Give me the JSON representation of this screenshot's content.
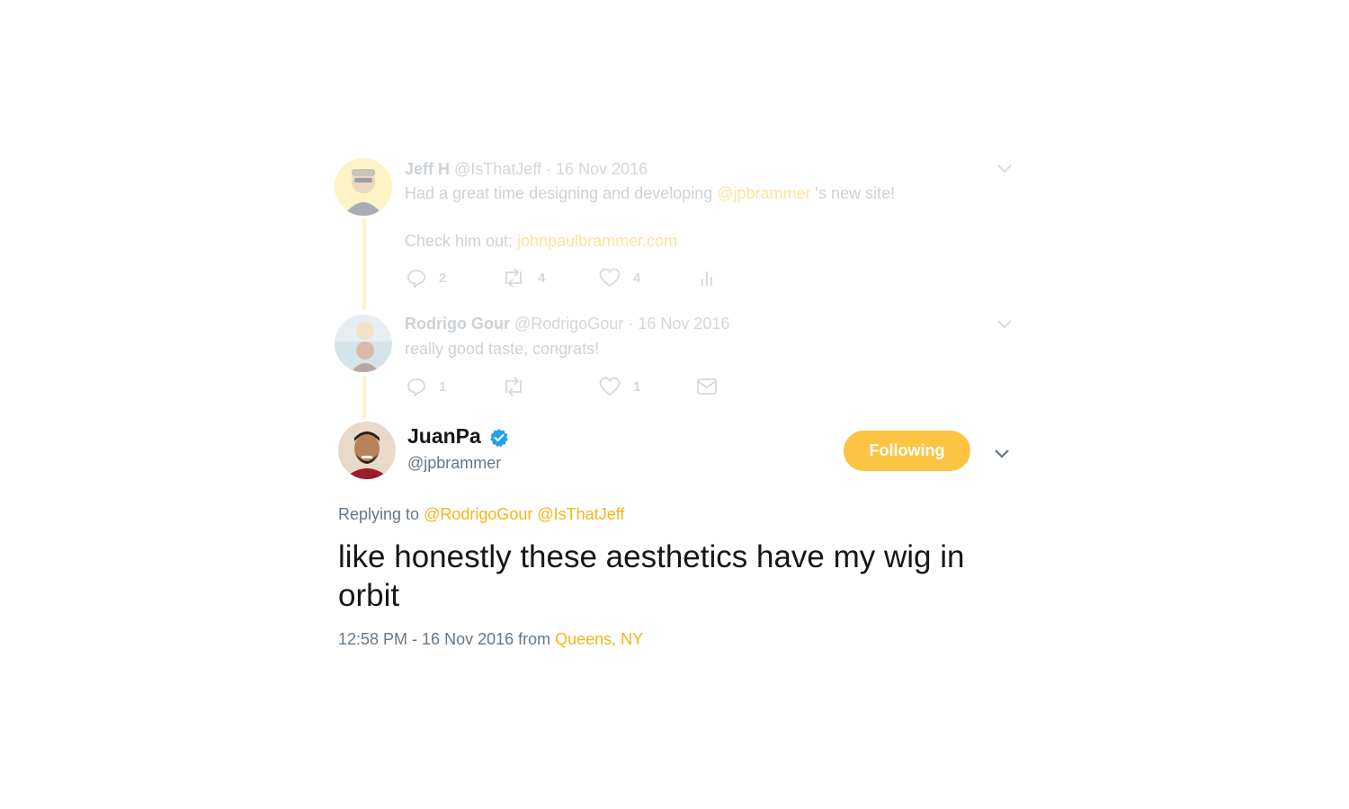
{
  "thread": [
    {
      "name": "Jeff H",
      "handle": "@IsThatJeff",
      "separator": "·",
      "date": "16 Nov 2016",
      "text_prefix": "Had a great time designing and developing ",
      "mention": "@jpbrammer",
      "text_suffix": " 's new site!",
      "text2_prefix": "Check him out: ",
      "link": "johnpaulbrammer.com",
      "replies": "2",
      "retweets": "4",
      "likes": "4"
    },
    {
      "name": "Rodrigo Gour",
      "handle": "@RodrigoGour",
      "separator": "·",
      "date": "16 Nov 2016",
      "text": "really good taste, congrats!",
      "replies": "1",
      "retweets": "",
      "likes": "1"
    }
  ],
  "main": {
    "name": "JuanPa",
    "handle": "@jpbrammer",
    "follow_label": "Following",
    "replying_prefix": "Replying to ",
    "replying_to_1": "@RodrigoGour",
    "replying_to_2": "@IsThatJeff",
    "text": "like honestly these aesthetics have my wig in orbit",
    "time": "12:58 PM - 16 Nov 2016",
    "from_label": " from ",
    "location": "Queens, NY"
  },
  "colors": {
    "accent": "#f5b419",
    "follow_button": "#fbc443",
    "verified": "#1da1f2",
    "thread_line": "#fdf0c8"
  },
  "icons": [
    "reply-icon",
    "retweet-icon",
    "like-icon",
    "analytics-icon",
    "dm-icon",
    "chevron-down-icon",
    "verified-badge-icon"
  ]
}
